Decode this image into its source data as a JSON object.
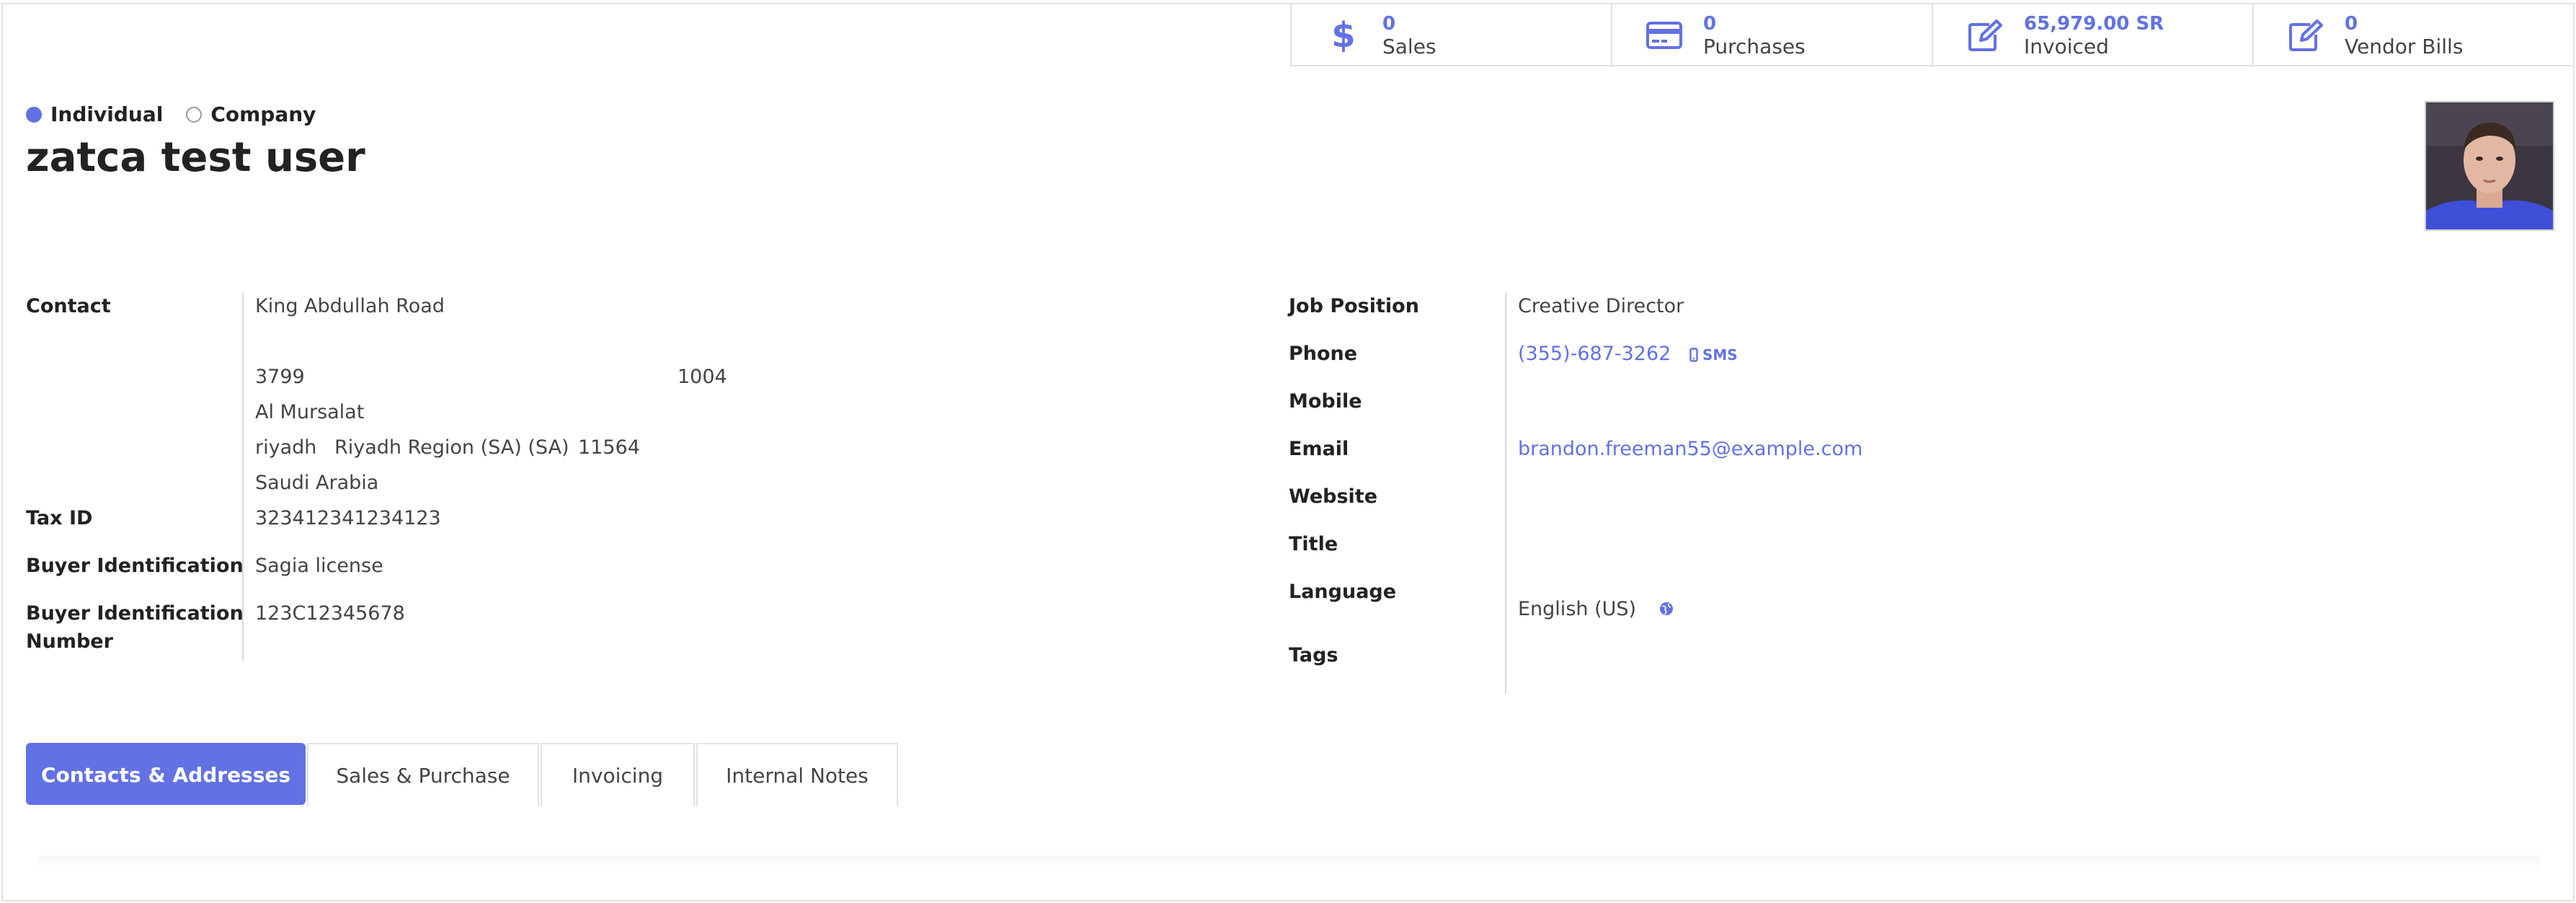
{
  "smart_buttons": [
    {
      "icon": "dollar-icon",
      "value": "0",
      "label": "Sales"
    },
    {
      "icon": "credit-card-icon",
      "value": "0",
      "label": "Purchases"
    },
    {
      "icon": "pencil-square-icon",
      "value": "65,979.00 SR",
      "label": "Invoiced"
    },
    {
      "icon": "pencil-square-icon",
      "value": "0",
      "label": "Vendor Bills"
    }
  ],
  "company_type": {
    "individual_label": "Individual",
    "company_label": "Company",
    "selected": "Individual"
  },
  "partner_name": "zatca test user",
  "left_fields": {
    "contact_label": "Contact",
    "street": "King Abdullah Road",
    "building_number": "3799",
    "plot_id": "1004",
    "district": "Al Mursalat",
    "city": "riyadh",
    "state": "Riyadh Region (SA) (SA)",
    "zip": "11564",
    "country": "Saudi Arabia",
    "tax_id_label": "Tax ID",
    "tax_id": "323412341234123",
    "buyer_id_label": "Buyer Identification",
    "buyer_id": "Sagia license",
    "buyer_id_number_label_1": "Buyer Identification",
    "buyer_id_number_label_2": "Number",
    "buyer_id_number": "123C12345678"
  },
  "right_fields": {
    "job_position_label": "Job Position",
    "job_position": "Creative Director",
    "phone_label": "Phone",
    "phone": "(355)-687-3262",
    "sms_label": "SMS",
    "mobile_label": "Mobile",
    "email_label": "Email",
    "email": "brandon.freeman55@example.com",
    "website_label": "Website",
    "title_label": "Title",
    "language_label": "Language",
    "language": "English (US)",
    "tags_label": "Tags"
  },
  "tabs": [
    {
      "label": "Contacts & Addresses",
      "active": true
    },
    {
      "label": "Sales & Purchase",
      "active": false
    },
    {
      "label": "Invoicing",
      "active": false
    },
    {
      "label": "Internal Notes",
      "active": false
    }
  ],
  "colors": {
    "accent": "#6271e4"
  }
}
